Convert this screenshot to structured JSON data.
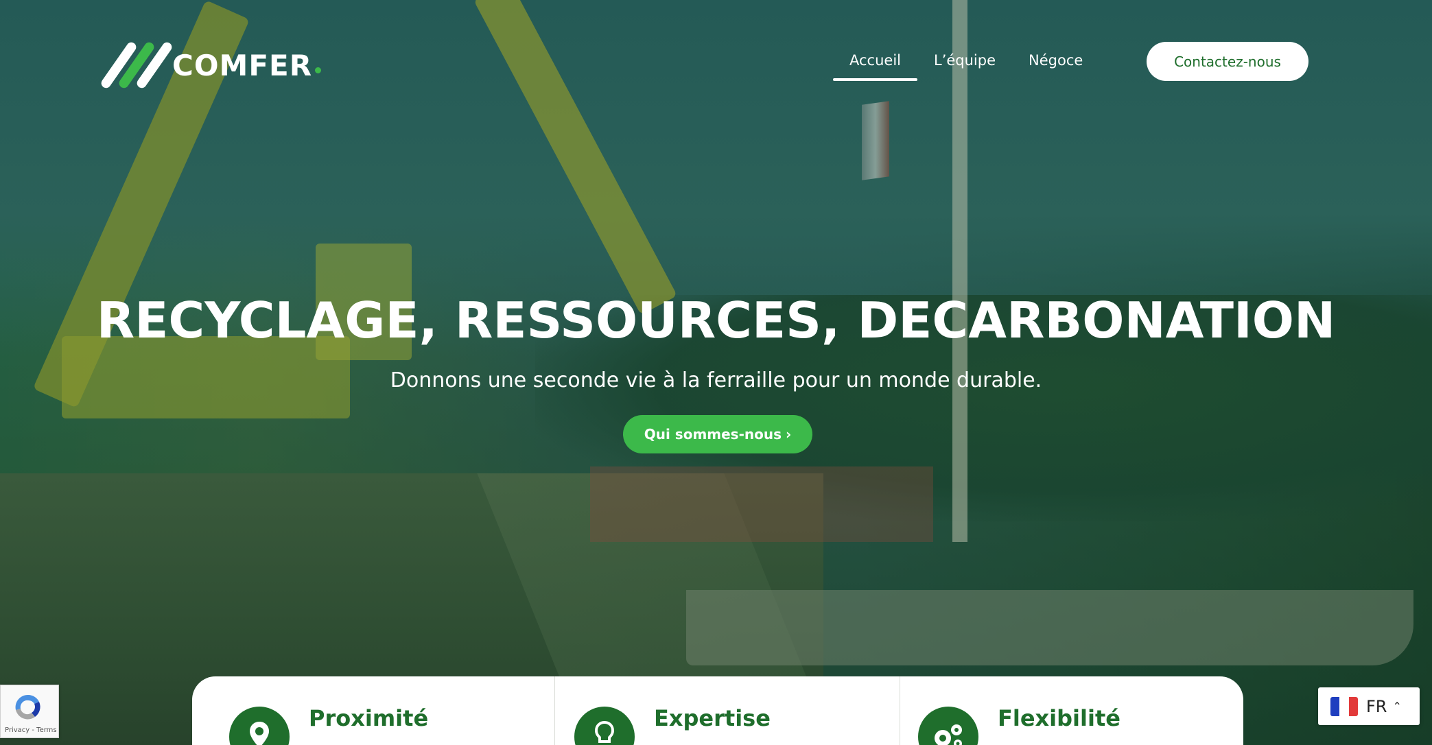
{
  "brand": {
    "name": "COMFER",
    "green": "#3cb94a",
    "dark_green": "#1f6e2c"
  },
  "nav": {
    "items": [
      {
        "label": "Accueil",
        "active": true
      },
      {
        "label": "L’équipe",
        "active": false
      },
      {
        "label": "Négoce",
        "active": false
      }
    ],
    "contact_label": "Contactez-nous"
  },
  "hero": {
    "title": "RECYCLAGE, RESSOURCES, DECARBONATION",
    "subtitle": "Donnons une seconde vie à la ferraille pour un monde durable.",
    "cta_label": "Qui sommes-nous",
    "cta_icon": "chevron-right-icon"
  },
  "features": [
    {
      "title": "Proximité",
      "icon": "map-pin-icon"
    },
    {
      "title": "Expertise",
      "icon": "lightbulb-icon"
    },
    {
      "title": "Flexibilité",
      "icon": "gears-icon"
    }
  ],
  "recaptcha": {
    "terms": "Privacy - Terms"
  },
  "language": {
    "code": "FR",
    "flag": "france-flag-icon"
  }
}
